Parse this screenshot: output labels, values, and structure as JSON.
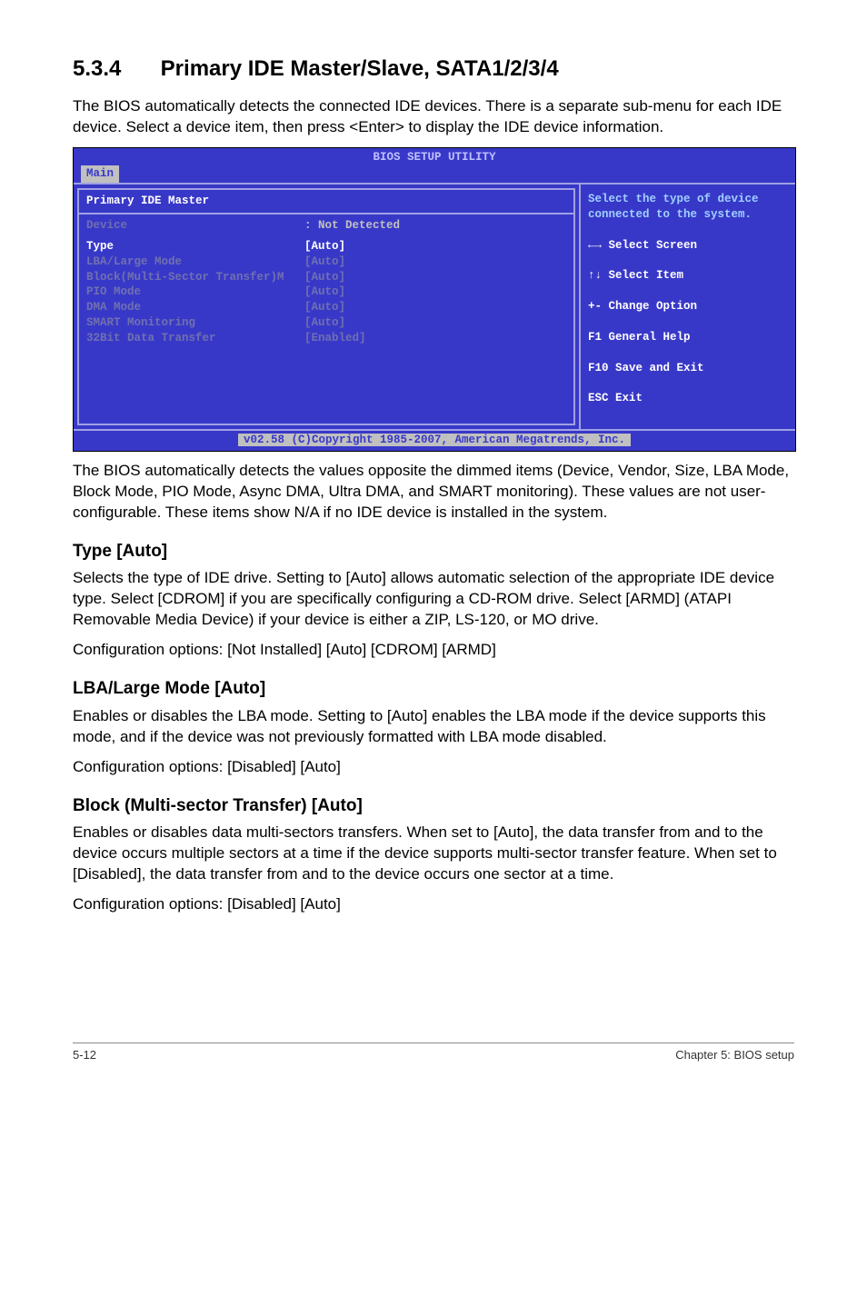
{
  "section": {
    "number": "5.3.4",
    "title": "Primary IDE Master/Slave, SATA1/2/3/4"
  },
  "intro": "The BIOS automatically detects the connected IDE devices. There is a separate sub-menu for each IDE device. Select a device item, then press <Enter> to display the IDE device information.",
  "bios": {
    "setupTitle": "BIOS SETUP UTILITY",
    "tab": "Main",
    "panelTitle": "Primary IDE Master",
    "deviceRow": {
      "label": "Device",
      "value": ": Not Detected"
    },
    "rows": [
      {
        "label": "Type",
        "value": "[Auto]"
      },
      {
        "label": "LBA/Large Mode",
        "value": "[Auto]"
      },
      {
        "label": "Block(Multi-Sector Transfer)M",
        "value": "[Auto]"
      },
      {
        "label": "PIO Mode",
        "value": "[Auto]"
      },
      {
        "label": "DMA Mode",
        "value": "[Auto]"
      },
      {
        "label": "SMART Monitoring",
        "value": "[Auto]"
      },
      {
        "label": "32Bit Data Transfer",
        "value": "[Enabled]"
      }
    ],
    "help": "Select the type of device connected to the system.",
    "keys": [
      "←→ Select Screen",
      "↑↓  Select Item",
      "+-  Change Option",
      "F1  General Help",
      "F10 Save and Exit",
      "ESC Exit"
    ],
    "footer": "v02.58 (C)Copyright 1985-2007, American Megatrends, Inc."
  },
  "afterBios": "The BIOS automatically detects the values opposite the dimmed items (Device, Vendor, Size, LBA Mode, Block Mode, PIO Mode, Async DMA, Ultra DMA, and SMART monitoring). These values are not user-configurable. These items show N/A if no IDE device is installed in the system.",
  "typeSection": {
    "heading": "Type [Auto]",
    "body": "Selects the type of IDE drive. Setting to [Auto] allows automatic selection of the appropriate IDE device type. Select [CDROM] if you are specifically configuring a CD-ROM drive. Select [ARMD] (ATAPI Removable Media Device) if your device is either a ZIP, LS-120, or MO drive.",
    "opts": "Configuration options: [Not Installed] [Auto] [CDROM] [ARMD]"
  },
  "lbaSection": {
    "heading": "LBA/Large Mode [Auto]",
    "body": "Enables or disables the LBA mode. Setting to [Auto] enables the LBA mode if the device supports this mode, and if the device was not previously formatted with LBA mode disabled.",
    "opts": "Configuration options: [Disabled] [Auto]"
  },
  "blockSection": {
    "heading": "Block (Multi-sector Transfer) [Auto]",
    "body": "Enables or disables data multi-sectors transfers. When set to [Auto], the data transfer from and to the device occurs multiple sectors at a time if the device supports multi-sector transfer feature. When set to [Disabled], the data transfer from and to the device occurs one sector at a time.",
    "opts": "Configuration options: [Disabled] [Auto]"
  },
  "pageFooter": {
    "left": "5-12",
    "right": "Chapter 5: BIOS setup"
  }
}
